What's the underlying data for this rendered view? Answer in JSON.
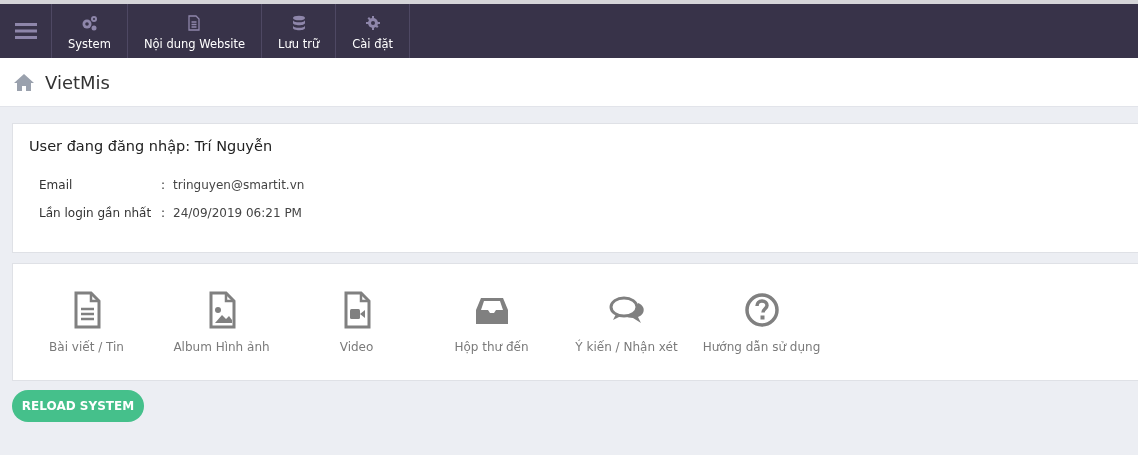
{
  "nav": [
    {
      "label": "System"
    },
    {
      "label": "Nội dung Website"
    },
    {
      "label": "Lưu trữ"
    },
    {
      "label": "Cài đặt"
    }
  ],
  "breadcrumb": {
    "title": "VietMis"
  },
  "user_card": {
    "heading": "User đang đăng nhập: Trí Nguyễn",
    "fields": [
      {
        "label": "Email",
        "separator": ":",
        "value": "tringuyen@smartit.vn"
      },
      {
        "label": "Lần login gần nhất",
        "separator": ":",
        "value": "24/09/2019 06:21 PM"
      }
    ]
  },
  "shortcuts": [
    {
      "label": "Bài viết / Tin"
    },
    {
      "label": "Album Hình ảnh"
    },
    {
      "label": "Video"
    },
    {
      "label": "Hộp thư đến"
    },
    {
      "label": "Ý kiến / Nhận xét"
    },
    {
      "label": "Hướng dẫn sử dụng"
    }
  ],
  "reload_button": "RELOAD SYSTEM"
}
